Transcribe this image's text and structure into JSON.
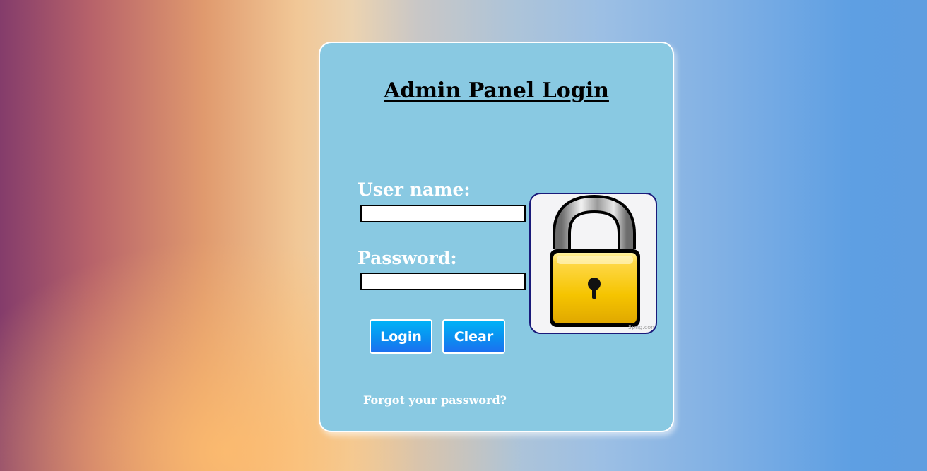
{
  "login_panel": {
    "title": "Admin Panel Login",
    "username_label": "User name:",
    "username_value": "",
    "password_label": "Password:",
    "password_value": "",
    "login_button": "Login",
    "clear_button": "Clear",
    "forgot_link": "Forgot your password?",
    "lock_image": {
      "icon": "padlock-icon",
      "watermark": "5png.com"
    }
  },
  "colors": {
    "panel_background": "#89c9e2",
    "panel_border": "#ffffff",
    "button_gradient_top": "#00b3f7",
    "button_gradient_bottom": "#1d6ff0",
    "lock_body": "#f5c400",
    "lock_border": "#1a1a7a"
  }
}
